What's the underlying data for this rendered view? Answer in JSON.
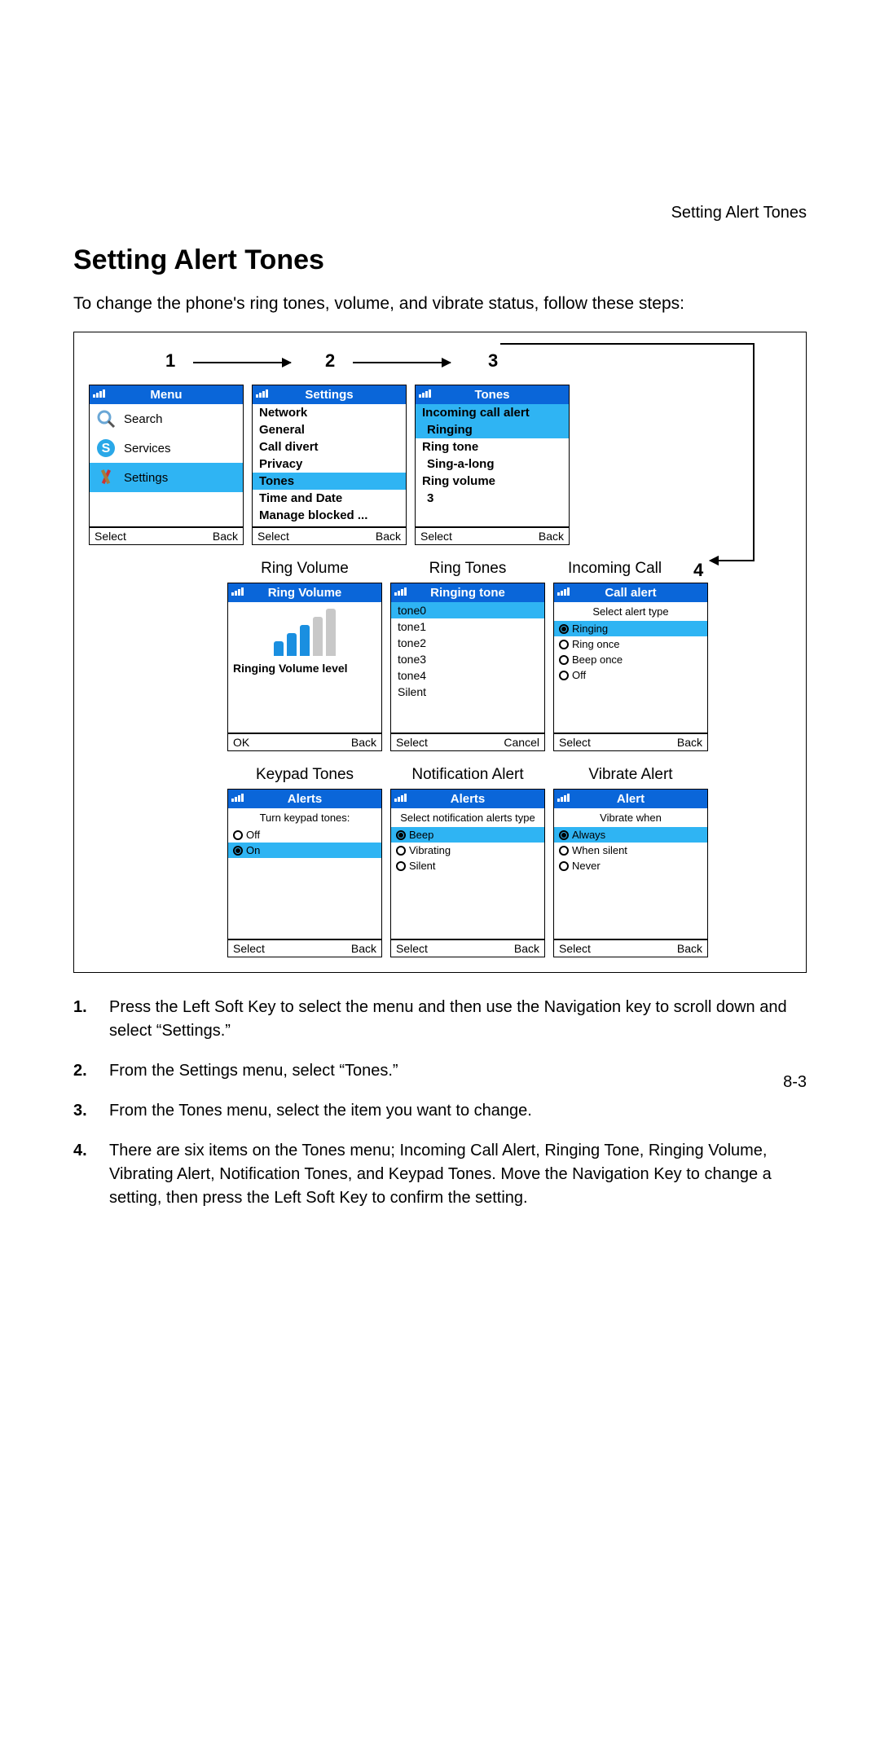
{
  "breadcrumb": "Setting Alert Tones",
  "page_title": "Setting Alert Tones",
  "intro_text": "To change the phone's ring tones, volume, and vibrate status, follow these steps:",
  "step_numbers": {
    "s1": "1",
    "s2": "2",
    "s3": "3",
    "s4": "4"
  },
  "row1": {
    "menu": {
      "title": "Menu",
      "items": [
        "Search",
        "Services",
        "Settings"
      ],
      "selected_index": 2,
      "soft_left": "Select",
      "soft_right": "Back"
    },
    "settings": {
      "title": "Settings",
      "items": [
        "Network",
        "General",
        "Call divert",
        "Privacy",
        "Tones",
        "Time and Date",
        "Manage blocked ..."
      ],
      "selected_index": 4,
      "soft_left": "Select",
      "soft_right": "Back"
    },
    "tones": {
      "title": "Tones",
      "groups": [
        {
          "header": "Incoming call alert",
          "value": "Ringing",
          "selected": true
        },
        {
          "header": "Ring tone",
          "value": "Sing-a-long"
        },
        {
          "header": "Ring volume",
          "value": "3"
        }
      ],
      "soft_left": "Select",
      "soft_right": "Back"
    }
  },
  "row2": {
    "ring_volume": {
      "label": "Ring Volume",
      "title": "Ring Volume",
      "caption": "Ringing Volume level",
      "soft_left": "OK",
      "soft_right": "Back"
    },
    "ring_tones": {
      "label": "Ring Tones",
      "title": "Ringing tone",
      "items": [
        "tone0",
        "tone1",
        "tone2",
        "tone3",
        "tone4",
        "Silent"
      ],
      "selected_index": 0,
      "soft_left": "Select",
      "soft_right": "Cancel"
    },
    "incoming_call": {
      "label": "Incoming Call",
      "title": "Call alert",
      "caption": "Select alert type",
      "options": [
        "Ringing",
        "Ring once",
        "Beep once",
        "Off"
      ],
      "selected_index": 0,
      "soft_left": "Select",
      "soft_right": "Back"
    }
  },
  "row3": {
    "keypad": {
      "label": "Keypad Tones",
      "title": "Alerts",
      "caption": "Turn keypad tones:",
      "options": [
        "Off",
        "On"
      ],
      "selected_index": 1,
      "soft_left": "Select",
      "soft_right": "Back"
    },
    "notification": {
      "label": "Notification Alert",
      "title": "Alerts",
      "caption": "Select notification alerts type",
      "options": [
        "Beep",
        "Vibrating",
        "Silent"
      ],
      "selected_index": 0,
      "soft_left": "Select",
      "soft_right": "Back"
    },
    "vibrate": {
      "label": "Vibrate Alert",
      "title": "Alert",
      "caption": "Vibrate when",
      "options": [
        "Always",
        "When silent",
        "Never"
      ],
      "selected_index": 0,
      "soft_left": "Select",
      "soft_right": "Back"
    }
  },
  "steps": [
    "Press the Left Soft Key to select the menu and then use the Navigation key to scroll down and select “Settings.”",
    "From the Settings menu, select “Tones.”",
    "From the Tones menu, select the item you want to change.",
    "There are six items on the Tones menu; Incoming Call Alert, Ringing Tone, Ringing Volume, Vibrating Alert, Notification Tones, and Keypad Tones. Move the Navigation Key to change a setting, then press the Left Soft Key to confirm the setting."
  ],
  "step_labels": [
    "1.",
    "2.",
    "3.",
    "4."
  ],
  "page_number": "8-3"
}
